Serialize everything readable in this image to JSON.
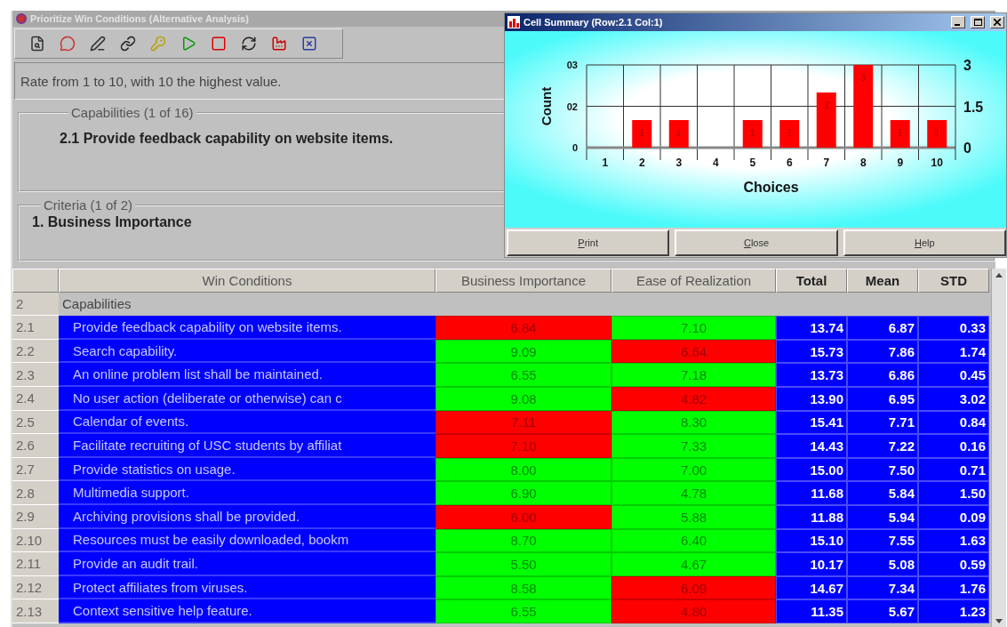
{
  "window": {
    "title": "Prioritize Win Conditions (Alternative Analysis)"
  },
  "instruction": "Rate from 1 to 10, with 10 the highest value.",
  "capabilities": {
    "legend": "Capabilities (1 of 16)",
    "item": "2.1 Provide feedback capability on website items."
  },
  "criteria": {
    "legend": "Criteria (1 of 2)",
    "item": "1. Business Importance"
  },
  "table": {
    "columns": [
      {
        "label": "Win Conditions",
        "kind": "plain"
      },
      {
        "label": "Business Importance",
        "kind": "plain"
      },
      {
        "label": "Ease of Realization",
        "kind": "plain"
      },
      {
        "label": "Total",
        "kind": "stat"
      },
      {
        "label": "Mean",
        "kind": "stat"
      },
      {
        "label": "STD",
        "kind": "stat"
      }
    ],
    "group": {
      "number": "2",
      "label": "Capabilities"
    },
    "rows": [
      {
        "number": "2.1",
        "condition": "Provide feedback capability on website items.",
        "ratings": [
          {
            "value": "6.84",
            "low": true
          },
          {
            "value": "7.10",
            "low": false
          }
        ],
        "total": "13.74",
        "mean": "6.87",
        "std": "0.33"
      },
      {
        "number": "2.2",
        "condition": "Search capability.",
        "ratings": [
          {
            "value": "9.09",
            "low": false
          },
          {
            "value": "6.64",
            "low": true
          }
        ],
        "total": "15.73",
        "mean": "7.86",
        "std": "1.74"
      },
      {
        "number": "2.3",
        "condition": "An online problem list shall be maintained.",
        "ratings": [
          {
            "value": "6.55",
            "low": false
          },
          {
            "value": "7.18",
            "low": false
          }
        ],
        "total": "13.73",
        "mean": "6.86",
        "std": "0.45"
      },
      {
        "number": "2.4",
        "condition": "No user action (deliberate or otherwise) can c",
        "ratings": [
          {
            "value": "9.08",
            "low": false
          },
          {
            "value": "4.82",
            "low": true
          }
        ],
        "total": "13.90",
        "mean": "6.95",
        "std": "3.02"
      },
      {
        "number": "2.5",
        "condition": "Calendar of events.",
        "ratings": [
          {
            "value": "7.11",
            "low": true
          },
          {
            "value": "8.30",
            "low": false
          }
        ],
        "total": "15.41",
        "mean": "7.71",
        "std": "0.84"
      },
      {
        "number": "2.6",
        "condition": "Facilitate recruiting of USC students by affiliat",
        "ratings": [
          {
            "value": "7.10",
            "low": true
          },
          {
            "value": "7.33",
            "low": false
          }
        ],
        "total": "14.43",
        "mean": "7.22",
        "std": "0.16"
      },
      {
        "number": "2.7",
        "condition": "Provide statistics on usage.",
        "ratings": [
          {
            "value": "8.00",
            "low": false
          },
          {
            "value": "7.00",
            "low": false
          }
        ],
        "total": "15.00",
        "mean": "7.50",
        "std": "0.71"
      },
      {
        "number": "2.8",
        "condition": "Multimedia support.",
        "ratings": [
          {
            "value": "6.90",
            "low": false
          },
          {
            "value": "4.78",
            "low": false
          }
        ],
        "total": "11.68",
        "mean": "5.84",
        "std": "1.50"
      },
      {
        "number": "2.9",
        "condition": "Archiving provisions shall be provided.",
        "ratings": [
          {
            "value": "6.00",
            "low": true
          },
          {
            "value": "5.88",
            "low": false
          }
        ],
        "total": "11.88",
        "mean": "5.94",
        "std": "0.09"
      },
      {
        "number": "2.10",
        "condition": "Resources must be easily downloaded, bookm",
        "ratings": [
          {
            "value": "8.70",
            "low": false
          },
          {
            "value": "6.40",
            "low": false
          }
        ],
        "total": "15.10",
        "mean": "7.55",
        "std": "1.63"
      },
      {
        "number": "2.11",
        "condition": "Provide an audit trail.",
        "ratings": [
          {
            "value": "5.50",
            "low": false
          },
          {
            "value": "4.67",
            "low": false
          }
        ],
        "total": "10.17",
        "mean": "5.08",
        "std": "0.59"
      },
      {
        "number": "2.12",
        "condition": "Protect affiliates from viruses.",
        "ratings": [
          {
            "value": "8.58",
            "low": false
          },
          {
            "value": "6.09",
            "low": true
          }
        ],
        "total": "14.67",
        "mean": "7.34",
        "std": "1.76"
      },
      {
        "number": "2.13",
        "condition": "Context sensitive help feature.",
        "ratings": [
          {
            "value": "6.55",
            "low": false
          },
          {
            "value": "4.80",
            "low": true
          }
        ],
        "total": "11.35",
        "mean": "5.67",
        "std": "1.23"
      }
    ]
  },
  "dialog": {
    "title": "Cell Summary (Row:2.1 Col:1)",
    "chart_data": {
      "type": "bar",
      "xlabel": "Choices",
      "ylabel": "Count",
      "categories": [
        "1",
        "2",
        "3",
        "4",
        "5",
        "6",
        "7",
        "8",
        "9",
        "10"
      ],
      "series": [
        {
          "color": "#ff0000",
          "values": [
            0,
            1,
            1,
            0,
            1,
            1,
            2,
            3,
            1,
            1
          ]
        }
      ],
      "ylim": [
        0,
        3
      ],
      "yticks": [
        {
          "value": 0,
          "label": "0"
        },
        {
          "value": 1.5,
          "label": "02"
        },
        {
          "value": 3,
          "label": "03"
        }
      ],
      "value_labels": [
        null,
        "1",
        "1",
        null,
        "1",
        "1",
        "2",
        "3",
        "1",
        "1"
      ]
    },
    "right_ticks": [
      "3",
      "1.5",
      "0"
    ],
    "buttons": [
      "Print",
      "Close",
      "Help"
    ]
  }
}
